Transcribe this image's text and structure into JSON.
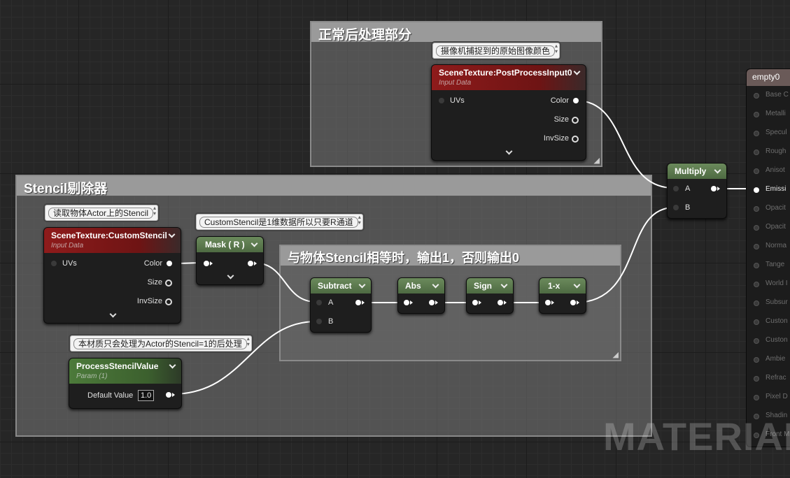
{
  "comments": {
    "postprocess_title": "正常后处理部分",
    "stencil_title": "Stencil剔除器",
    "equal_title": "与物体Stencil相等时，输出1，否则输出0"
  },
  "bubbles": {
    "postprocess": "摄像机捕捉到的原始图像颜色",
    "custom_stencil": "读取物体Actor上的Stencil",
    "mask": "CustomStencil是1维数据所以只要R通道",
    "param": "本材质只会处理为Actor的Stencil=1的后处理"
  },
  "nodes": {
    "scene_tex_pp": {
      "title": "SceneTexture:PostProcessInput0",
      "subtitle": "Input Data",
      "input": "UVs",
      "outputs": [
        "Color",
        "Size",
        "InvSize"
      ]
    },
    "scene_tex_cs": {
      "title": "SceneTexture:CustomStencil",
      "subtitle": "Input Data",
      "input": "UVs",
      "outputs": [
        "Color",
        "Size",
        "InvSize"
      ]
    },
    "mask": {
      "title": "Mask ( R )"
    },
    "subtract": {
      "title": "Subtract",
      "inputs": [
        "A",
        "B"
      ]
    },
    "abs": {
      "title": "Abs"
    },
    "sign": {
      "title": "Sign"
    },
    "one_minus": {
      "title": "1-x"
    },
    "multiply": {
      "title": "Multiply",
      "inputs": [
        "A",
        "B"
      ]
    },
    "param": {
      "title": "ProcessStencilValue",
      "subtitle": "Param (1)",
      "label": "Default Value",
      "value": "1.0"
    }
  },
  "material": {
    "title": "empty0",
    "pins": [
      "Base C",
      "Metalli",
      "Specul",
      "Rough",
      "Anisot",
      "Emissi",
      "Opacit",
      "Opacit",
      "Norma",
      "Tange",
      "World I",
      "Subsur",
      "Custon",
      "Custon",
      "Ambie",
      "Refrac",
      "Pixel D",
      "Shadin",
      "Front M"
    ],
    "active_pin": "Emissi"
  },
  "watermark": "MATERIAL",
  "colors": {
    "wire": "#ffffff",
    "input_header": "#8e1b1b",
    "op_header": "#5b7a4e",
    "param_header": "#4c7a3a"
  }
}
